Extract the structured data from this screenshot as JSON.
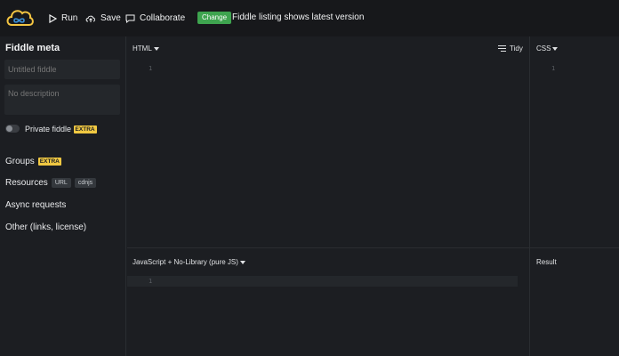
{
  "toolbar": {
    "run_label": "Run",
    "save_label": "Save",
    "collaborate_label": "Collaborate",
    "change_badge": "Change",
    "change_text": "Fiddle listing shows latest version"
  },
  "sidebar": {
    "title": "Fiddle meta",
    "title_placeholder": "Untitled fiddle",
    "description_placeholder": "No description",
    "private_label": "Private fiddle",
    "extra_badge": "EXTRA",
    "groups_label": "Groups",
    "resources_label": "Resources",
    "resources_chips": [
      "URL",
      "cdnjs"
    ],
    "async_label": "Async requests",
    "other_label": "Other (links, license)"
  },
  "editors": {
    "html_label": "HTML",
    "css_label": "CSS",
    "js_label": "JavaScript + No-Library (pure JS)",
    "result_label": "Result",
    "tidy_label": "Tidy",
    "line_number": "1"
  },
  "colors": {
    "accent_green": "#3ea44f",
    "extra_yellow": "#f0c842",
    "logo_yellow": "#f4c542",
    "logo_blue": "#3b8fd6"
  }
}
